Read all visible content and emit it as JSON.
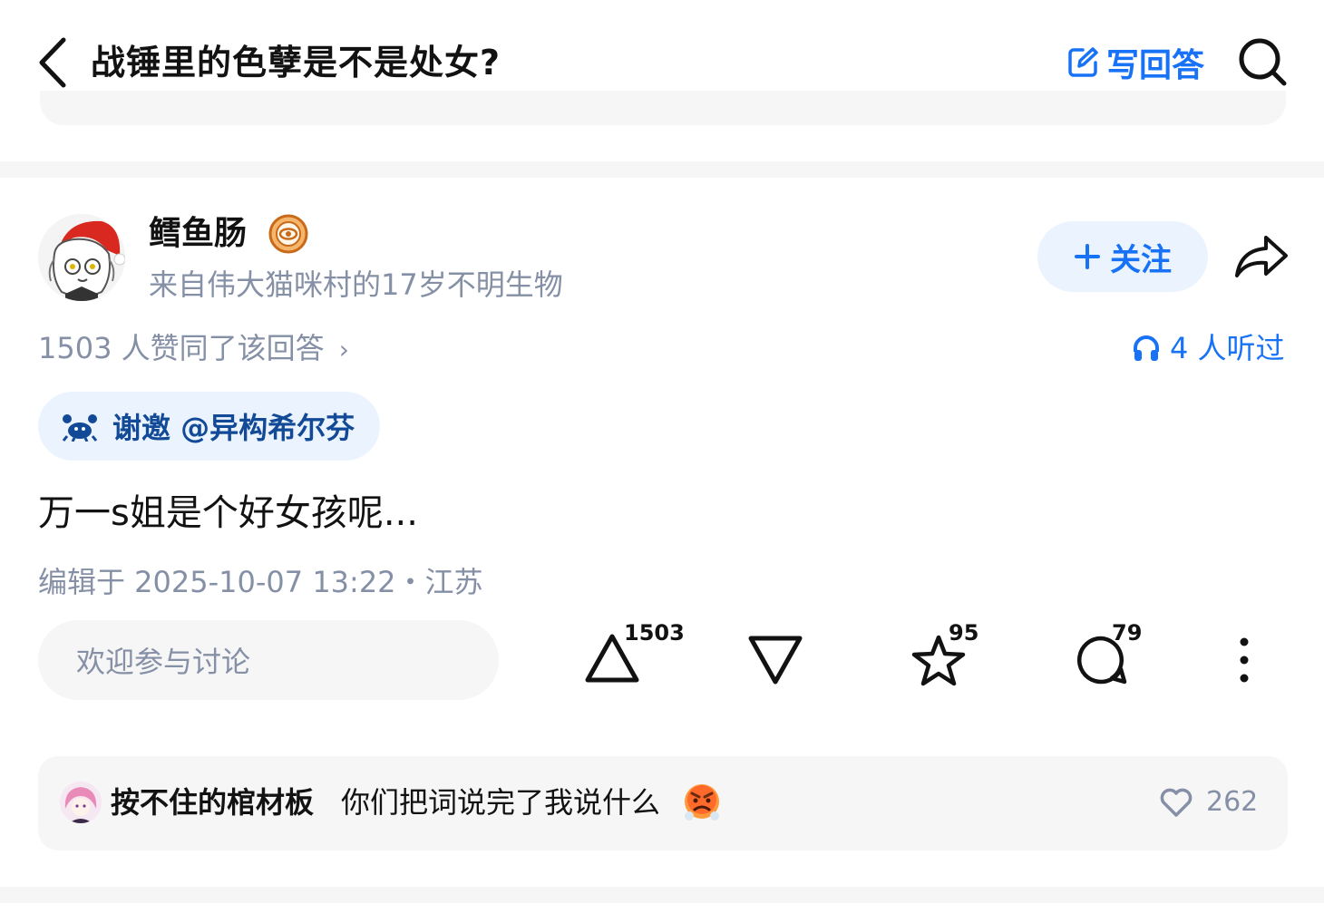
{
  "header": {
    "title": "战锤里的色孽是不是处女?",
    "write_answer_label": "写回答",
    "icons": {
      "back": "chevron-left-icon",
      "write": "edit-icon",
      "search": "search-icon"
    }
  },
  "answer": {
    "author": {
      "name": "鳕鱼肠",
      "bio": "来自伟大猫咪村的17岁不明生物",
      "badge_icon": "eye-badge-icon"
    },
    "follow_label": "关注",
    "likes_summary": "1503 人赞同了该回答",
    "listen_text": "4 人听过",
    "invite_text": "谢邀 @异构希尔芬",
    "content": "万一s姐是个好女孩呢...",
    "edit_meta": "编辑于 2025-10-07 13:22・江苏",
    "comment_placeholder": "欢迎参与讨论",
    "actions": {
      "upvote_count": "1503",
      "favorite_count": "95",
      "comment_count": "79"
    }
  },
  "hot_comment": {
    "user": "按不住的棺材板",
    "text": "你们把词说完了我说什么",
    "emoji": "angry-face",
    "like_count": "262"
  },
  "colors": {
    "accent": "#1772f6",
    "accent_bg": "#ebf4fe",
    "invite_text": "#124a97",
    "secondary_text": "#8590a6",
    "card_bg": "#f6f6f6"
  }
}
